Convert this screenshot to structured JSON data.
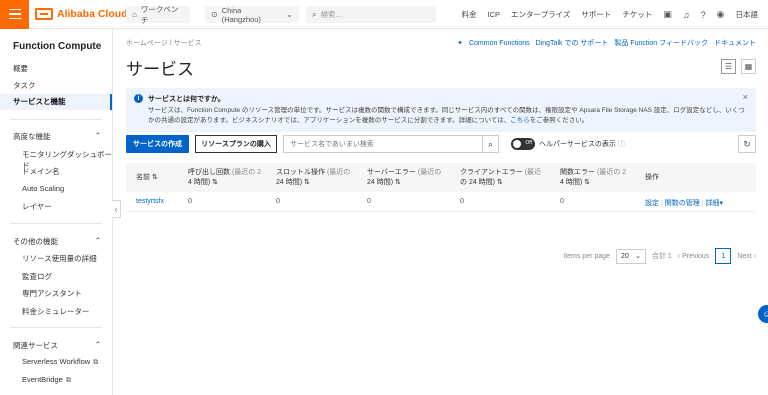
{
  "brand": {
    "name": "Alibaba Cloud"
  },
  "topbar": {
    "workbench": "ワークベンチ",
    "region": "China (Hangzhou)",
    "search_placeholder": "検索...",
    "nav": [
      "料金",
      "ICP",
      "エンタープライズ",
      "サポート",
      "チケット"
    ],
    "lang": "日本語"
  },
  "sidebar": {
    "title": "Function Compute",
    "items": [
      "概要",
      "タスク",
      "サービスと機能"
    ],
    "group1": {
      "label": "高度な機能",
      "items": [
        "モニタリングダッシュボード",
        "ドメイン名",
        "Auto Scaling",
        "レイヤー"
      ]
    },
    "group2": {
      "label": "その他の機能",
      "items": [
        "リソース使用量の詳細",
        "監査ログ",
        "専門アシスタント",
        "料金シミュレーター"
      ]
    },
    "group3": {
      "label": "関連サービス",
      "items": [
        "Serverless Workflow",
        "EventBridge"
      ]
    }
  },
  "main": {
    "breadcrumb": "ホームページ  /  サービス",
    "toplinks": [
      "Common Functions",
      "DingTalk での サポート",
      "製品 Function フィードバック",
      "ドキュメント"
    ],
    "title": "サービス",
    "notice": {
      "title": "サービスとは何ですか。",
      "body": "サービスは、Function Compute のリソース管理の単位です。サービスは複数の関数で構成できます。同じサービス内のすべての関数は、権限設定や Apsara File Storage NAS 設定、ログ設定などし、いくつかの共通の設定があります。ビジネスシナリオでは、アプリケーションを複数のサービスに分割できます。詳細については、",
      "link": "こちら",
      "suffix": "をご参照ください。"
    },
    "toolbar": {
      "create": "サービスの作成",
      "buy": "リソースプランの購入",
      "search_placeholder": "サービス名であいまい検索",
      "toggle": "Off",
      "toggle_label": "ヘルパーサービスの表示"
    },
    "table": {
      "headers": [
        {
          "l1": "名前",
          "l2": ""
        },
        {
          "l1": "呼び出し回数",
          "g1": " (最近の 2",
          "l2": "4 時間)"
        },
        {
          "l1": "スロットル操作",
          "g1": " (最近の",
          "l2": "24 時間)"
        },
        {
          "l1": "サーバーエラー",
          "g1": " (最近の",
          "l2": "24 時間)"
        },
        {
          "l1": "クライアントエラー",
          "g1": " (最近",
          "l2": "の 24 時間)"
        },
        {
          "l1": "関数エラー",
          "g1": " (最近の 2",
          "l2": "4 時間)"
        },
        {
          "l1": "操作",
          "l2": ""
        }
      ],
      "rows": [
        {
          "name": "testyrtsfx",
          "invocations": "0",
          "throttles": "0",
          "server_errors": "0",
          "client_errors": "0",
          "function_errors": "0",
          "actions": [
            "設定",
            "関数の管理",
            "詳細"
          ]
        }
      ]
    },
    "pager": {
      "items_label": "Items per page",
      "size": "20",
      "total": "合計 1",
      "prev": "Previous",
      "page": "1",
      "next": "Next"
    }
  }
}
